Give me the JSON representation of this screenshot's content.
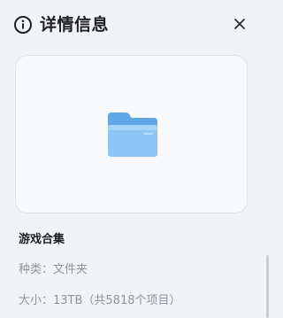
{
  "header": {
    "title": "详情信息",
    "info_icon": "info-circle-icon",
    "close_icon": "close-icon"
  },
  "preview": {
    "icon": "folder-icon",
    "folder_color": "#8ec6f6"
  },
  "details": {
    "name": "游戏合集",
    "type_line": "种类：文件夹",
    "size_line": "大小：13TB（共5818个项目）"
  },
  "colors": {
    "background": "#f1f4f7",
    "card_background": "#f8f9fb",
    "title_text": "#1f1f24",
    "secondary_text": "#8d949c"
  }
}
